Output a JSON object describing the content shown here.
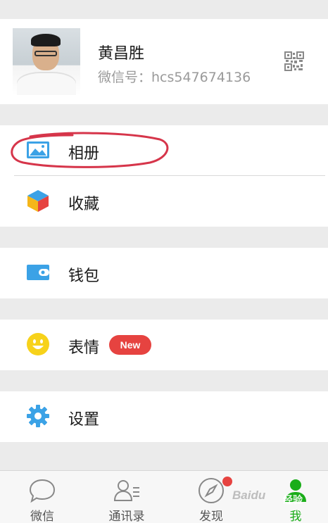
{
  "profile": {
    "name": "黄昌胜",
    "wechat_id": "微信号：hcs547674136"
  },
  "menu": {
    "album": {
      "label": "相册",
      "icon": "album-icon"
    },
    "favorites": {
      "label": "收藏",
      "icon": "cube-icon"
    },
    "wallet": {
      "label": "钱包",
      "icon": "wallet-icon"
    },
    "stickers": {
      "label": "表情",
      "icon": "smiley-icon",
      "badge": "New"
    },
    "settings": {
      "label": "设置",
      "icon": "gear-icon"
    }
  },
  "tabbar": {
    "tabs": [
      {
        "label": "微信",
        "icon": "chat-bubble-icon"
      },
      {
        "label": "通讯录",
        "icon": "contacts-icon"
      },
      {
        "label": "发现",
        "icon": "compass-icon"
      },
      {
        "label": "我",
        "icon": "person-icon"
      }
    ],
    "active_index": 3
  },
  "watermark": {
    "text": "Baidu",
    "text2": "经验"
  },
  "colors": {
    "accent_green": "#1aad19",
    "badge_red": "#e64340",
    "icon_blue": "#3ba2e6",
    "annotation_red": "#d6354a"
  }
}
